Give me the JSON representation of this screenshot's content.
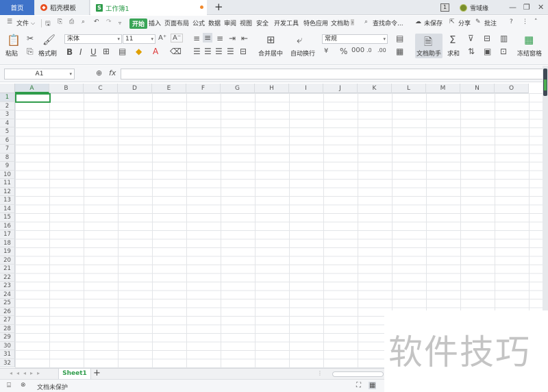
{
  "tabs": {
    "home": "首页",
    "template_store": "稻壳模板",
    "workbook": "工作簿1",
    "add": "+"
  },
  "window": {
    "badge": "1",
    "user": "雪域缘"
  },
  "menu": {
    "file": "文件",
    "items": [
      "开始",
      "插入",
      "页面布局",
      "公式",
      "数据",
      "审阅",
      "视图",
      "安全",
      "开发工具",
      "特色应用",
      "文档助"
    ],
    "search": "查找命令...",
    "unsaved": "未保存",
    "share": "分享",
    "comment": "批注"
  },
  "ribbon": {
    "paste": "粘贴",
    "format_painter": "格式刷",
    "font_name": "宋体",
    "font_size": "11",
    "merge_center": "合并居中",
    "auto_wrap": "自动换行",
    "number_format": "常规",
    "doc_assistant": "文档助手",
    "sum": "求和",
    "freeze": "冻结窗格"
  },
  "formula_bar": {
    "name_box": "A1",
    "fx": "fx",
    "formula": ""
  },
  "grid": {
    "columns": [
      "A",
      "B",
      "C",
      "D",
      "E",
      "F",
      "G",
      "H",
      "I",
      "J",
      "K",
      "L",
      "M",
      "N",
      "O"
    ],
    "rows": [
      "1",
      "2",
      "3",
      "4",
      "5",
      "6",
      "7",
      "8",
      "9",
      "10",
      "11",
      "12",
      "13",
      "14",
      "15",
      "16",
      "17",
      "18",
      "19",
      "20",
      "21",
      "22",
      "23",
      "24",
      "25",
      "26",
      "27",
      "28",
      "29",
      "30",
      "31",
      "32"
    ],
    "active_cell": "A1"
  },
  "sheets": {
    "active": "Sheet1"
  },
  "status": {
    "protection": "文档未保护"
  },
  "watermark": "软件技巧",
  "colors": {
    "accent_green": "#2f9c4b",
    "home_tab_blue": "#3f73c9"
  }
}
